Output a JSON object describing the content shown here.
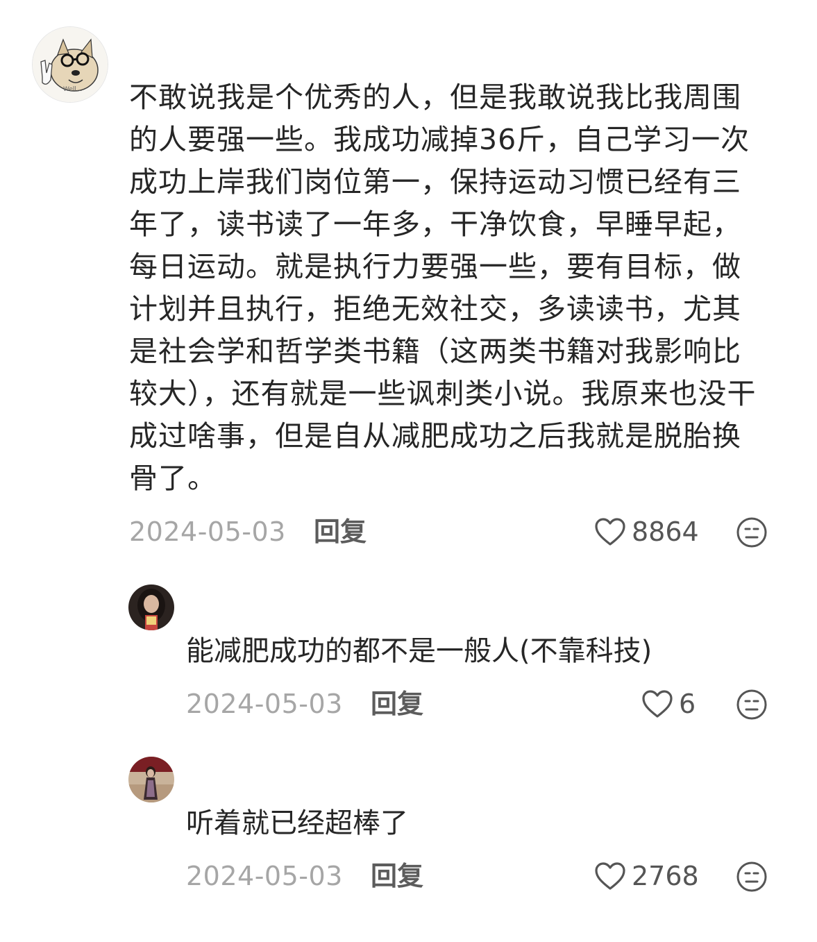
{
  "comment": {
    "text": "不敢说我是个优秀的人，但是我敢说我比我周围的人要强一些。我成功减掉36斤，自己学习一次成功上岸我们岗位第一，保持运动习惯已经有三年了，读书读了一年多，干净饮食，早睡早起，每日运动。就是执行力要强一些，要有目标，做计划并且执行，拒绝无效社交，多读读书，尤其是社会学和哲学类书籍（这两类书籍对我影响比较大），还有就是一些讽刺类小说。我原来也没干成过啥事，但是自从减肥成功之后我就是脱胎换骨了。",
    "avatar_caption": "Well...",
    "date": "2024-05-03",
    "reply_label": "回复",
    "likes": "8864"
  },
  "replies": [
    {
      "text": "能减肥成功的都不是一般人(不靠科技)",
      "date": "2024-05-03",
      "reply_label": "回复",
      "likes": "6"
    },
    {
      "text": "听着就已经超棒了",
      "date": "2024-05-03",
      "reply_label": "回复",
      "likes": "2768"
    }
  ],
  "icons": {
    "like": "heart-outline-icon",
    "dislike": "meh-face-icon"
  },
  "colors": {
    "text": "#262626",
    "date": "#a6a6a6",
    "reply": "#5c5c5c",
    "icon": "#555555"
  }
}
